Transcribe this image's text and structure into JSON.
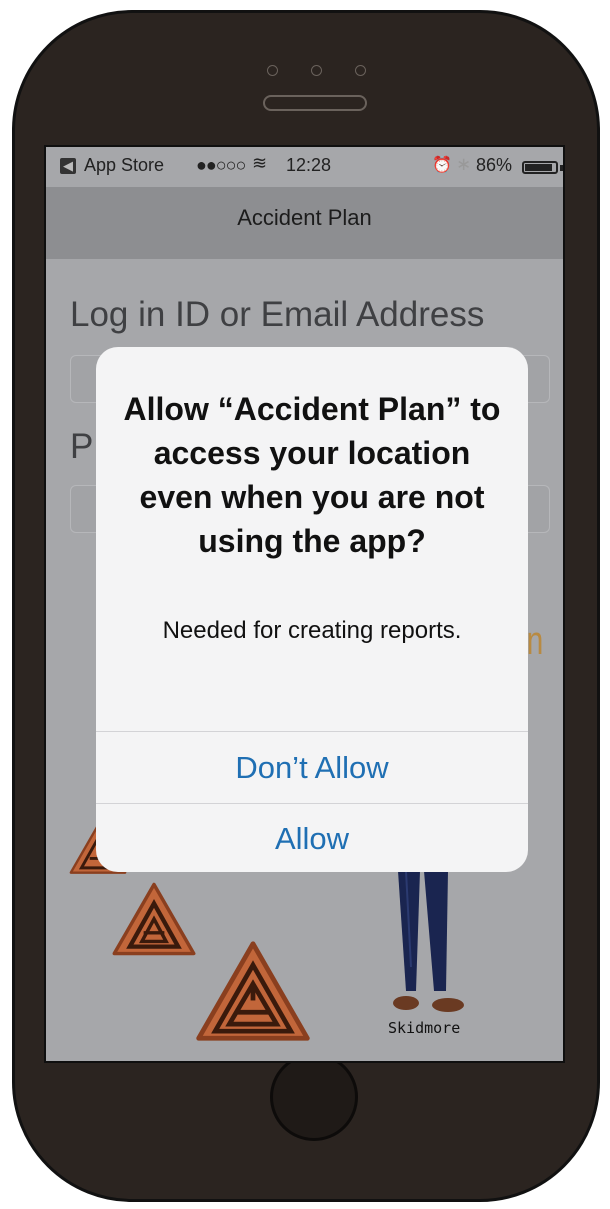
{
  "status_bar": {
    "app": "App Store",
    "signal": "●●○○○",
    "time": "12:28",
    "battery": "86%"
  },
  "nav": {
    "title": "Accident Plan"
  },
  "form": {
    "login_label": "Log in ID or Email Address",
    "password_label_partial": "P",
    "login_partial": "in"
  },
  "alert": {
    "title": "Allow “Accident Plan” to access your location even when you are not using the app?",
    "message": "Needed for creating reports.",
    "dont_allow": "Don’t Allow",
    "allow": "Allow"
  },
  "figure": {
    "label": "Skidmore"
  },
  "colors": {
    "accent_blue": "#1f6fb3",
    "logo_orange": "#c2663a"
  }
}
